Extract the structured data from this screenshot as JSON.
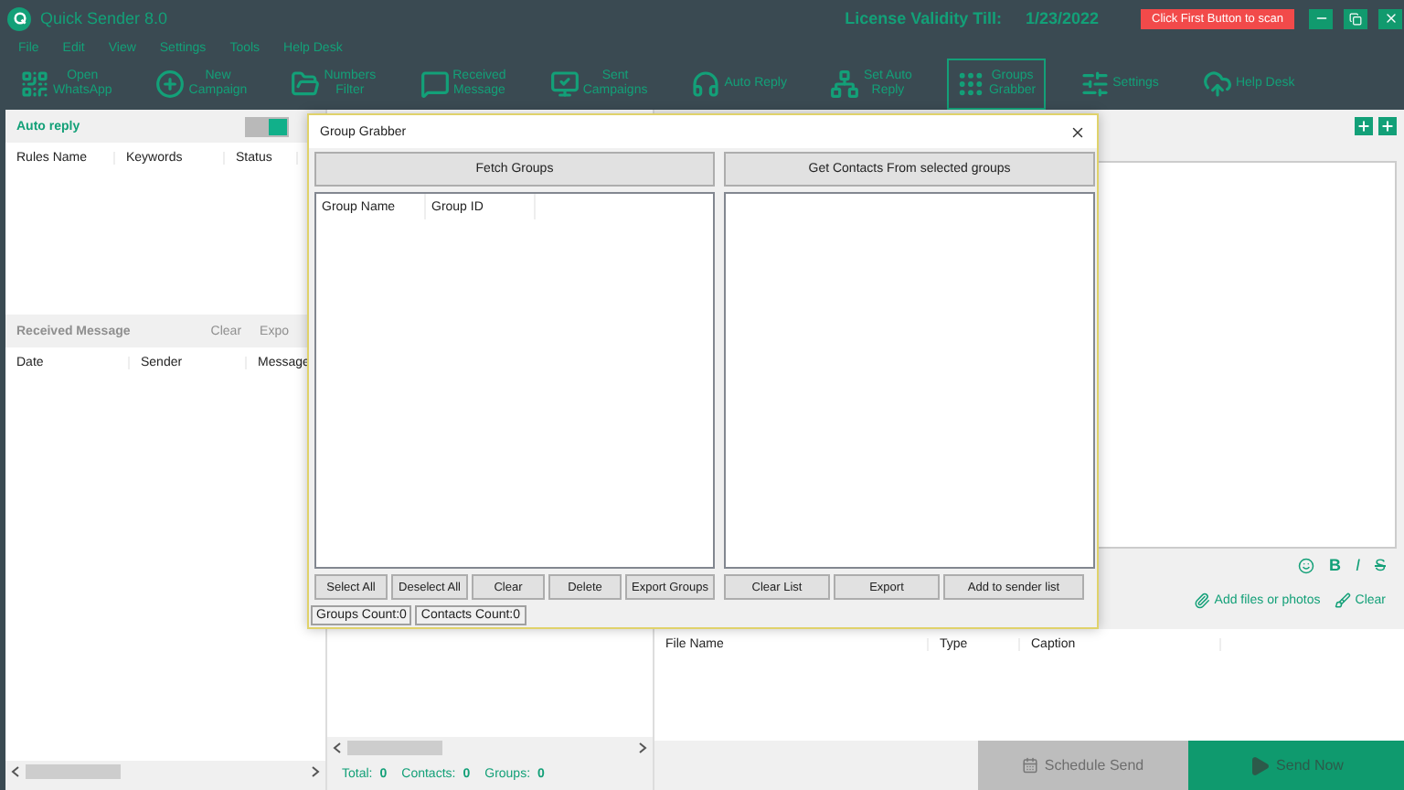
{
  "window": {
    "title": "Quick Sender 8.0",
    "license_label": "License Validity Till:",
    "license_date": "1/23/2022",
    "scan_button": "Click First Button to scan"
  },
  "menu": [
    "File",
    "Edit",
    "View",
    "Settings",
    "Tools",
    "Help Desk"
  ],
  "toolbar": [
    {
      "label": "Open\nWhatsApp",
      "selected": false
    },
    {
      "label": "New\nCampaign",
      "selected": false
    },
    {
      "label": "Numbers\nFilter",
      "selected": false
    },
    {
      "label": "Received\nMessage",
      "selected": false
    },
    {
      "label": "Sent\nCampaigns",
      "selected": false
    },
    {
      "label": "Auto Reply",
      "selected": false
    },
    {
      "label": "Set Auto\nReply",
      "selected": false
    },
    {
      "label": "Groups\nGrabber",
      "selected": true
    },
    {
      "label": "Settings",
      "selected": false
    },
    {
      "label": "Help Desk",
      "selected": false
    }
  ],
  "auto_reply": {
    "title": "Auto reply",
    "on": true,
    "columns": [
      "Rules Name",
      "Keywords",
      "Status"
    ]
  },
  "received": {
    "title": "Received Message",
    "actions": [
      "Clear",
      "Expo"
    ],
    "columns": [
      "Date",
      "Sender",
      "Message"
    ]
  },
  "totals": [
    {
      "label": "Total:",
      "value": "0"
    },
    {
      "label": "Contacts:",
      "value": "0"
    },
    {
      "label": "Groups:",
      "value": "0"
    }
  ],
  "format_buttons": [
    {
      "kind": "emoji"
    },
    {
      "kind": "bold",
      "text": "B"
    },
    {
      "kind": "italic",
      "text": "I"
    },
    {
      "kind": "strike",
      "text": "S"
    }
  ],
  "attachments": {
    "add_label": "Add files or photos",
    "clear_label": "Clear",
    "columns": [
      "File Name",
      "Type",
      "Caption"
    ]
  },
  "send": {
    "schedule": "Schedule Send",
    "send_now": "Send Now"
  },
  "dialog": {
    "title": "Group Grabber",
    "fetch": "Fetch Groups",
    "get_contacts": "Get Contacts From selected groups",
    "group_columns": [
      "Group Name",
      "Group ID"
    ],
    "left_buttons": [
      "Select All",
      "Deselect All",
      "Clear",
      "Delete",
      "Export Groups"
    ],
    "right_buttons": [
      "Clear List",
      "Export",
      "Add to sender list"
    ],
    "status": [
      "Groups Count:0",
      "Contacts Count:0"
    ]
  }
}
